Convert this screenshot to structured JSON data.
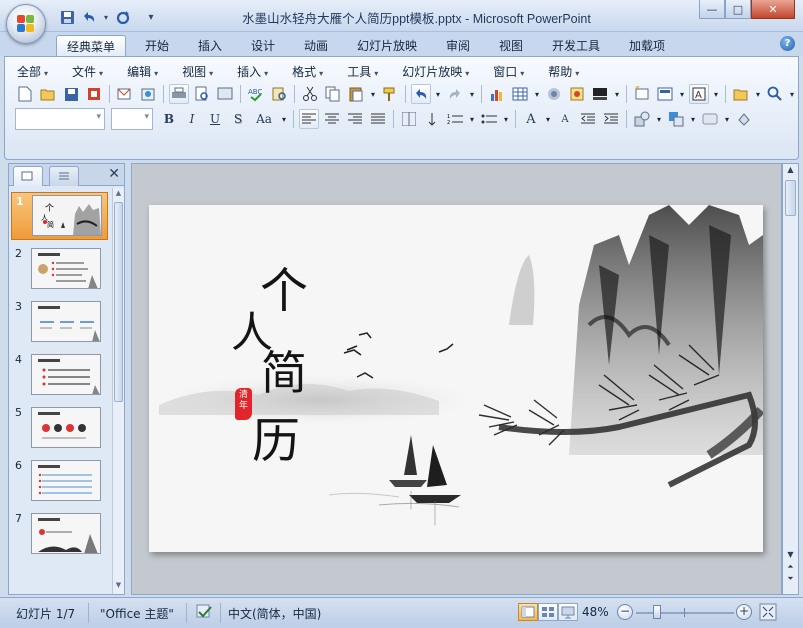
{
  "window": {
    "title": "水墨山水轻舟大雁个人简历ppt模板.pptx - Microsoft PowerPoint",
    "minimize": "—",
    "maximize": "□",
    "close": "✕"
  },
  "ribbon_tabs": [
    "经典菜单",
    "开始",
    "插入",
    "设计",
    "动画",
    "幻灯片放映",
    "审阅",
    "视图",
    "开发工具",
    "加载项"
  ],
  "active_tab": "经典菜单",
  "menu": [
    "全部",
    "文件",
    "编辑",
    "视图",
    "插入",
    "格式",
    "工具",
    "幻灯片放映",
    "窗口",
    "帮助"
  ],
  "format_buttons": {
    "bold": "B",
    "italic": "I",
    "underline": "U",
    "shadow": "S",
    "case": "Aa"
  },
  "font_buttons": {
    "grow": "A",
    "shrink": "A"
  },
  "slide_panel": {
    "close": "✕",
    "slides": [
      {
        "number": "1",
        "selected": true
      },
      {
        "number": "2",
        "selected": false
      },
      {
        "number": "3",
        "selected": false
      },
      {
        "number": "4",
        "selected": false
      },
      {
        "number": "5",
        "selected": false
      },
      {
        "number": "6",
        "selected": false
      },
      {
        "number": "7",
        "selected": false
      }
    ]
  },
  "slide": {
    "title_chars": [
      "个",
      "人",
      "简",
      "历"
    ],
    "seal_text": "清年"
  },
  "status": {
    "slide_info": "幻灯片 1/7",
    "theme": "\"Office 主题\"",
    "language": "中文(简体，中国)",
    "zoom": "48%",
    "zoom_level": 0.48
  },
  "colors": {
    "seal": "#e0262a",
    "accent": "#c9d8ee",
    "selected_thumb": "#f2a443"
  }
}
